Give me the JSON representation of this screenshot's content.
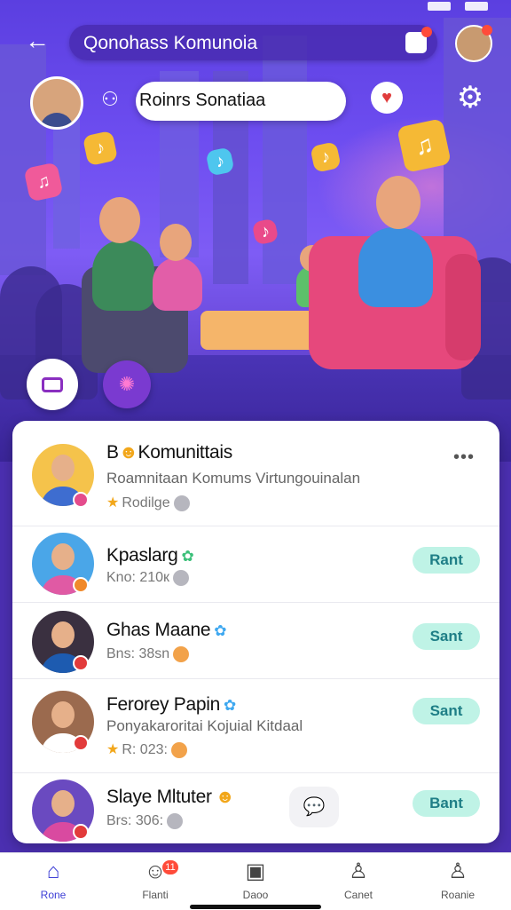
{
  "header": {
    "title": "Qonohass Komunoia",
    "back_icon": "back-arrow-icon"
  },
  "room": {
    "host_name": "Roinrs Sonatiaa"
  },
  "list": [
    {
      "name": "B",
      "name_suffix": "Komunittais",
      "subtitle": "Roamnitaan Komums Virtungouinalan",
      "meta": "Rodilge",
      "more_label": "•••",
      "avatar_shirt": "#3e6dd0",
      "badge_color": "#e44c8c",
      "bg": "#f5c34b"
    },
    {
      "name": "Kpaslarg",
      "meta": "Kno: 210к",
      "action": "Rant",
      "avatar_shirt": "#e05aa4",
      "badge_color": "#f08a2c",
      "bg": "#4aa6e8"
    },
    {
      "name": "Ghas Maane",
      "meta": "Bns: 38sn",
      "action": "Sant",
      "avatar_shirt": "#1d5bb0",
      "badge_color": "#e23b3b",
      "bg": "#3a3040"
    },
    {
      "name": "Ferorey Papin",
      "subtitle": "Ponyakaroritai Kojuial Kitdaal",
      "meta": "R: 023:",
      "action": "Sant",
      "avatar_shirt": "#ffffff",
      "badge_color": "#e23b3b",
      "bg": "#9b6a4e"
    },
    {
      "name": "Slaye Mltuter",
      "meta": "Brs: 306:",
      "action": "Bant",
      "avatar_shirt": "#d94aa0",
      "badge_color": "#e23b3b",
      "bg": "#6a4ac0"
    }
  ],
  "bottom_nav": [
    {
      "label": "Rone",
      "icon": "home-icon",
      "active": true
    },
    {
      "label": "Flanti",
      "icon": "chat-bubble-icon",
      "badge": "11"
    },
    {
      "label": "Daoo",
      "icon": "bag-icon"
    },
    {
      "label": "Canet",
      "icon": "person-outline-icon"
    },
    {
      "label": "Roanie",
      "icon": "profile-icon"
    }
  ],
  "colors": {
    "accent": "#3e3fd6",
    "action_bg": "#bff3e6",
    "action_text": "#1e7e86",
    "hero_top": "#5b3fe0",
    "notification": "#ff4b3a"
  }
}
